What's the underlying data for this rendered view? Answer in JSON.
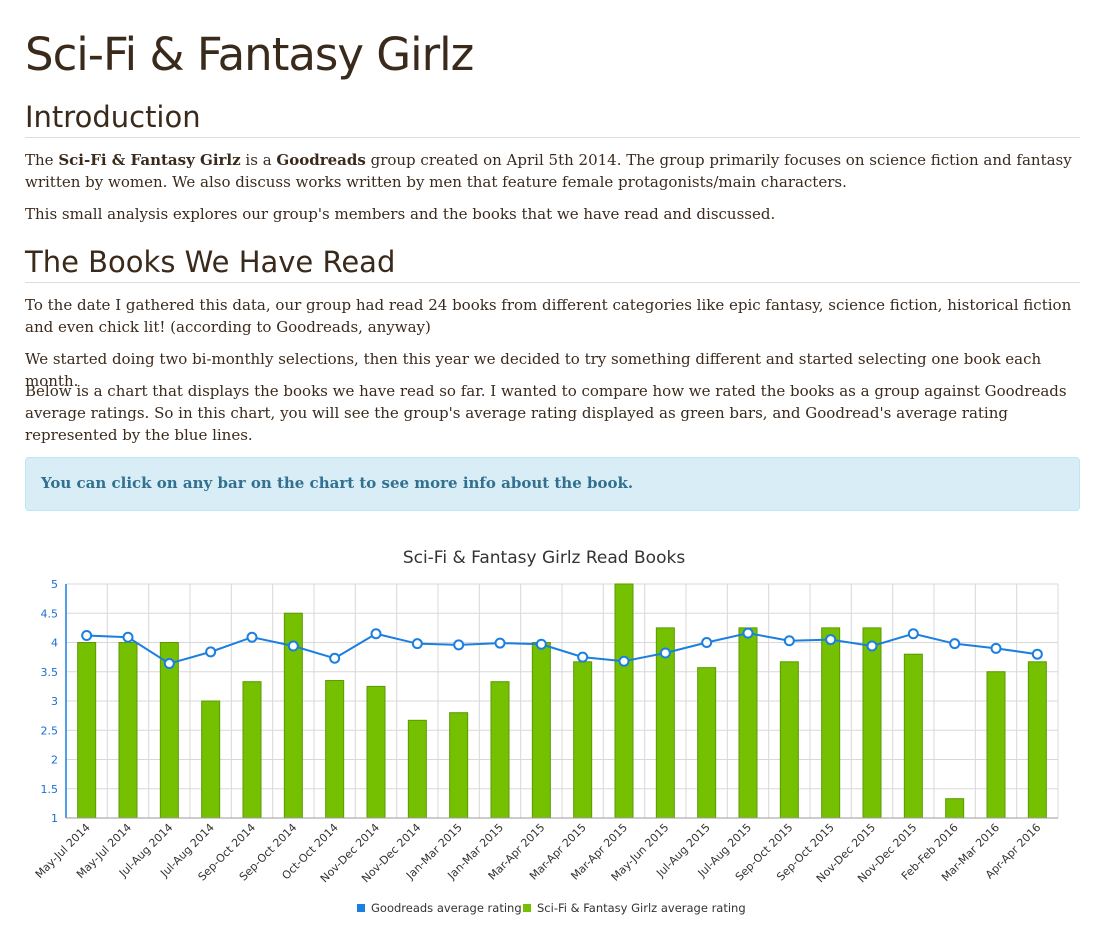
{
  "title": "Sci-Fi & Fantasy Girlz",
  "intro": {
    "heading": "Introduction",
    "p1_a": "The ",
    "p1_group": "Sci-Fi & Fantasy Girlz",
    "p1_b": " is a ",
    "p1_site": "Goodreads",
    "p1_c": " group created on April 5th 2014. The group primarily focuses on science fiction and fantasy written by women. We also discuss works written by men that feature female protagonists/main characters.",
    "p2": "This small analysis explores our group's members and the books that we have read and discussed."
  },
  "books": {
    "heading": "The Books We Have Read",
    "p1": "To the date I gathered this data, our group had read 24 books from different categories like epic fantasy, science fiction, historical fiction and even chick lit! (according to Goodreads, anyway)",
    "p2": "We started doing two bi-monthly selections, then this year we decided to try something different and started selecting one book each month.",
    "p3": "Below is a chart that displays the books we have read so far. I wanted to compare how we rated the books as a group against Goodreads average ratings. So in this chart, you will see the group's average rating displayed as green bars, and Goodread's average rating represented by the blue lines.",
    "alert": "You can click on any bar on the chart to see more info about the book."
  },
  "chart_data": {
    "type": "bar",
    "title": "Sci-Fi & Fantasy Girlz Read Books",
    "categories": [
      "May-Jul 2014",
      "May-Jul 2014",
      "Jul-Aug 2014",
      "Jul-Aug 2014",
      "Sep-Oct 2014",
      "Sep-Oct 2014",
      "Oct-Oct 2014",
      "Nov-Dec 2014",
      "Nov-Dec 2014",
      "Jan-Mar 2015",
      "Jan-Mar 2015",
      "Mar-Apr 2015",
      "Mar-Apr 2015",
      "Mar-Apr 2015",
      "May-Jun 2015",
      "Jul-Aug 2015",
      "Jul-Aug 2015",
      "Sep-Oct 2015",
      "Sep-Oct 2015",
      "Nov-Dec 2015",
      "Nov-Dec 2015",
      "Feb-Feb 2016",
      "Mar-Mar 2016",
      "Apr-Apr 2016"
    ],
    "series": [
      {
        "name": "Goodreads average rating",
        "type": "line",
        "color": "#1a7fe0",
        "values": [
          4.12,
          4.09,
          3.64,
          3.84,
          4.09,
          3.94,
          3.73,
          4.15,
          3.98,
          3.96,
          3.99,
          3.97,
          3.75,
          3.68,
          3.82,
          4.0,
          4.16,
          4.03,
          4.05,
          3.94,
          4.15,
          3.98,
          3.9,
          3.8
        ]
      },
      {
        "name": "Sci-Fi & Fantasy Girlz average rating",
        "type": "bar",
        "color": "#75c000",
        "values": [
          4.0,
          4.0,
          4.0,
          3.0,
          3.33,
          4.5,
          3.35,
          3.25,
          2.67,
          2.8,
          3.33,
          4.0,
          3.67,
          5.0,
          4.25,
          3.57,
          4.25,
          3.67,
          4.25,
          4.25,
          3.8,
          1.33,
          3.5,
          3.67
        ]
      }
    ],
    "ylim": [
      1,
      5
    ],
    "yticks": [
      "1",
      "1.5",
      "2",
      "2.5",
      "3",
      "3.5",
      "4",
      "4.5",
      "5"
    ],
    "legend_position": "bottom",
    "grid": true
  }
}
